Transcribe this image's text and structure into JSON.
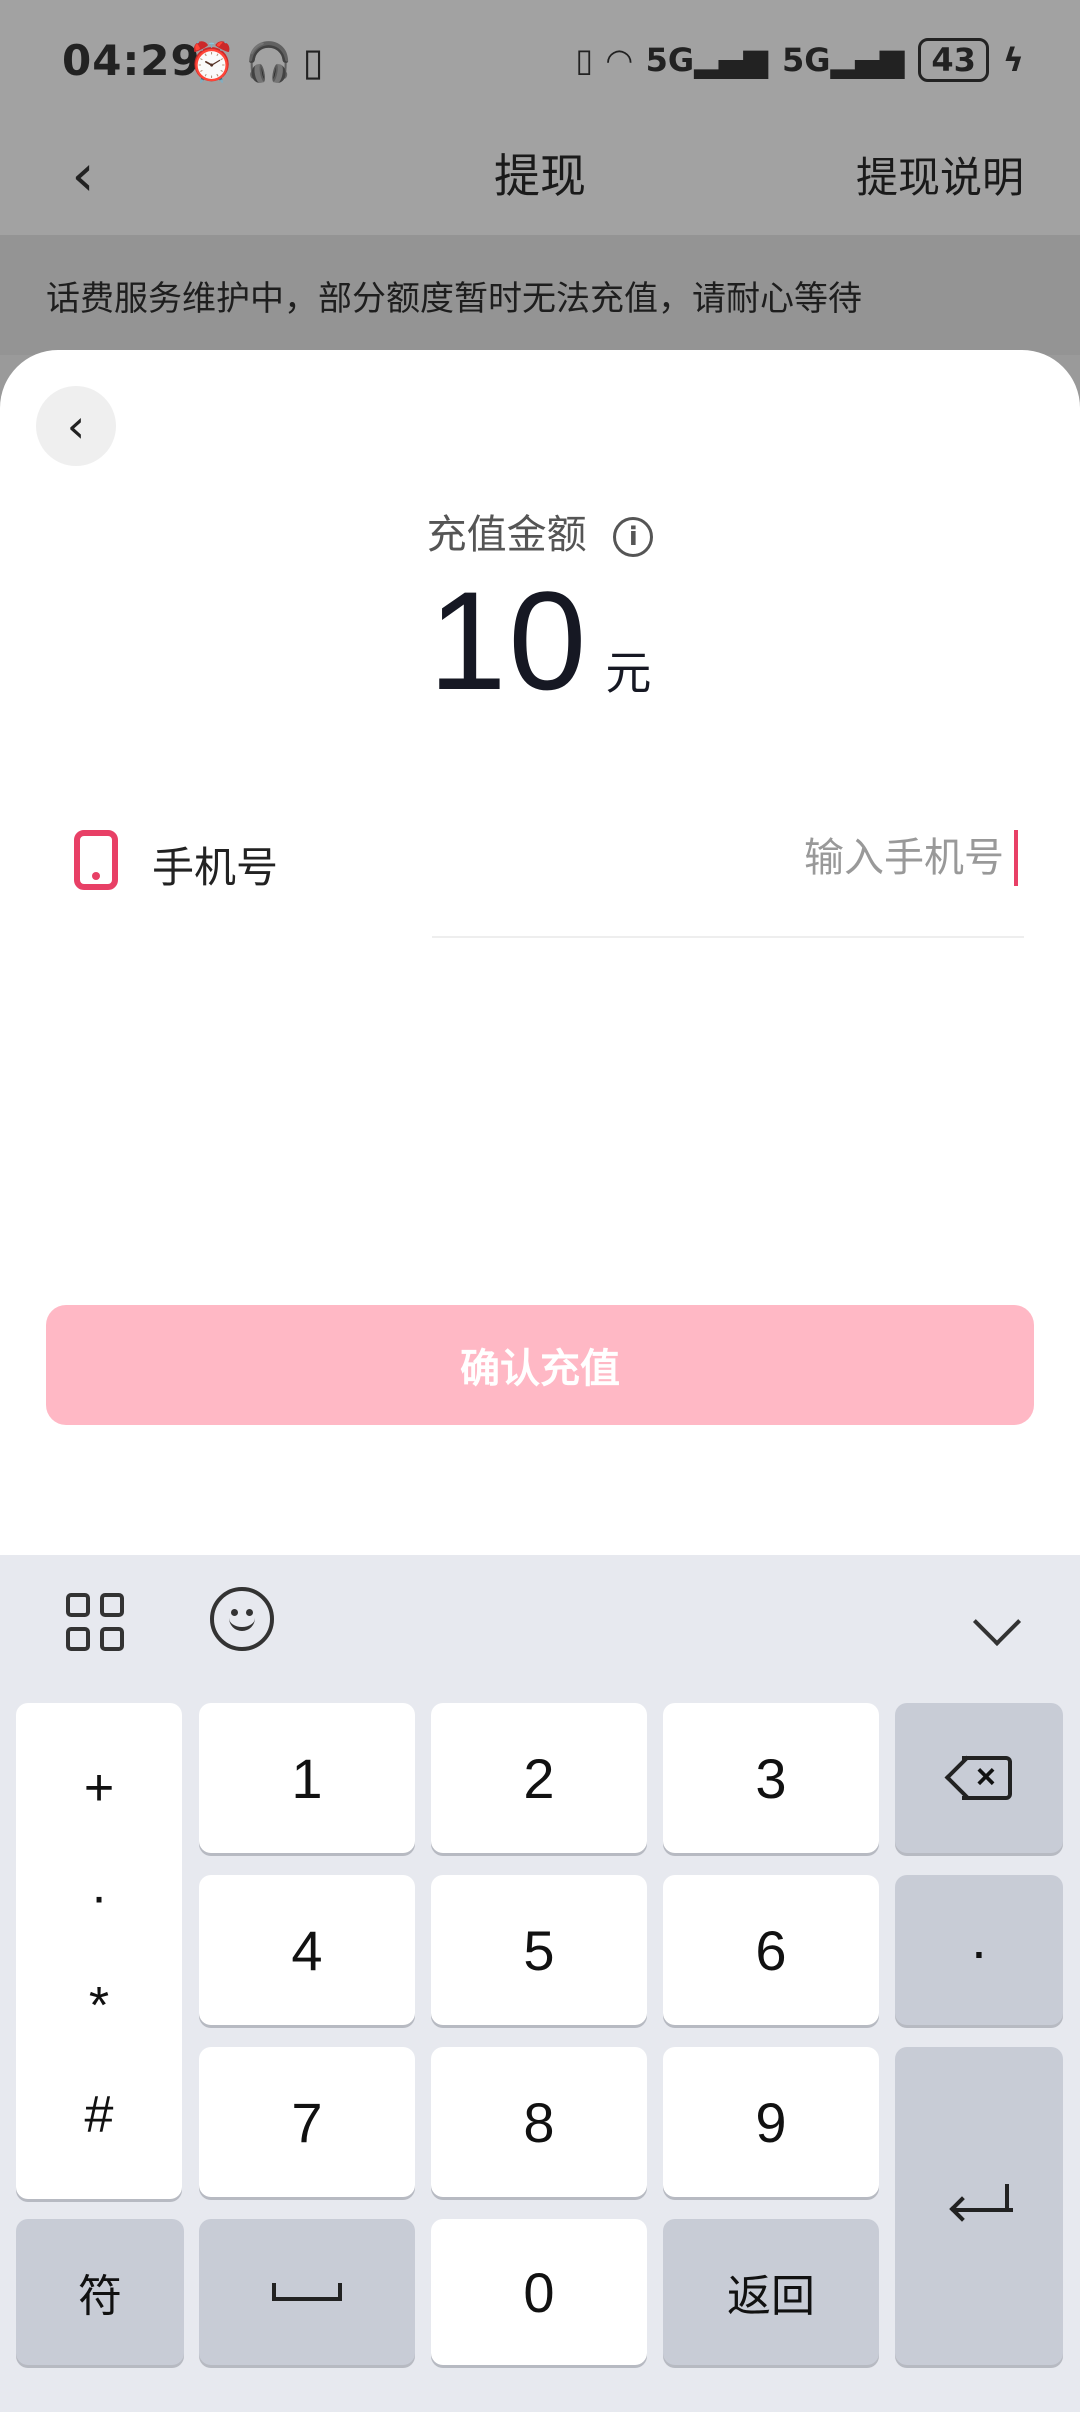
{
  "status_bar": {
    "time": "04:29",
    "left_icons": [
      "alarm-icon",
      "headphones-icon",
      "battery-saver-icon"
    ],
    "right_icons": [
      "vibrate-icon",
      "wifi-icon",
      "signal-5g-icon",
      "signal-5g-icon"
    ],
    "battery": "43"
  },
  "nav": {
    "title": "提现",
    "right_link": "提现说明"
  },
  "notice": "话费服务维护中，部分额度暂时无法充值，请耐心等待",
  "sheet": {
    "amount_label": "充值金额",
    "amount_value": "10",
    "amount_unit": "元",
    "phone_label": "手机号",
    "phone_placeholder": "输入手机号",
    "phone_value": "",
    "confirm_label": "确认充值"
  },
  "keyboard": {
    "symbols": [
      "+",
      "·",
      "*",
      "#"
    ],
    "keys": [
      "1",
      "2",
      "3",
      "4",
      "5",
      "6",
      "7",
      "8",
      "9",
      "0"
    ],
    "dot": "·",
    "symbol_switch": "符",
    "return_label": "返回"
  },
  "colors": {
    "accent": "#e84066",
    "button_disabled": "#ffb8c5",
    "keyboard_bg": "#e7e9ef"
  }
}
